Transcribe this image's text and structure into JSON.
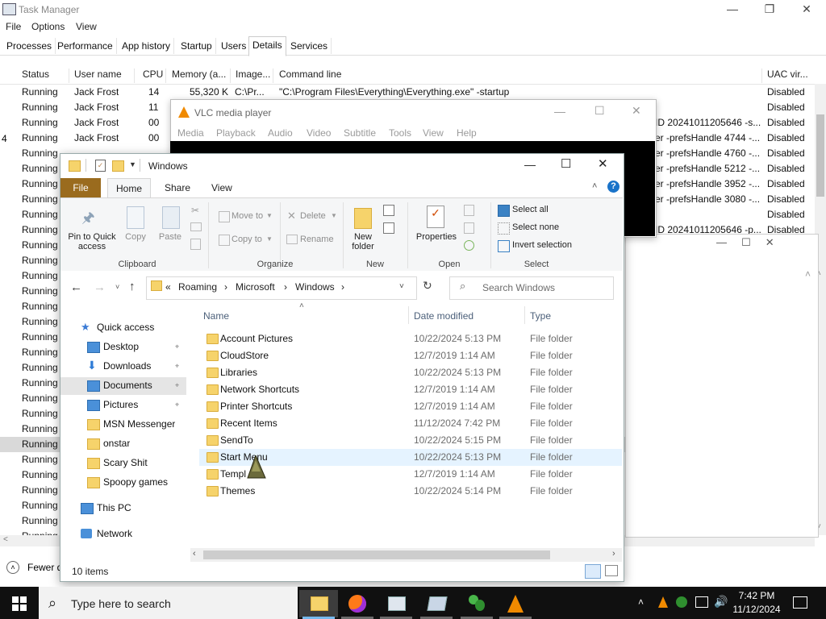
{
  "taskmgr": {
    "title": "Task Manager",
    "menu": [
      "File",
      "Options",
      "View"
    ],
    "tabs": [
      "Processes",
      "Performance",
      "App history",
      "Startup",
      "Users",
      "Details",
      "Services"
    ],
    "active_tab": "Details",
    "columns": [
      "Status",
      "User name",
      "CPU",
      "Memory (a...",
      "Image...",
      "Command line",
      "UAC vir..."
    ],
    "rows": [
      {
        "status": "Running",
        "user": "Jack Frost",
        "cpu": "14",
        "mem": "55,320 K",
        "image": "C:\\Pr...",
        "cmd": "\"C:\\Program Files\\Everything\\Everything.exe\" -startup",
        "uac": "Disabled"
      },
      {
        "status": "Running",
        "user": "Jack Frost",
        "cpu": "11",
        "mem": "",
        "image": "",
        "cmd": "",
        "uac": "Disabled"
      },
      {
        "status": "Running",
        "user": "Jack Frost",
        "cpu": "00",
        "mem": "",
        "image": "",
        "cmd": "ID 20241011205646 -s...",
        "uac": "Disabled"
      },
      {
        "status": "Running",
        "user": "Jack Frost",
        "cpu": "00",
        "mem": "",
        "image": "",
        "cmd": "er -prefsHandle 4744 -...",
        "uac": "Disabled"
      },
      {
        "status": "Running",
        "user": "",
        "cpu": "",
        "mem": "",
        "image": "",
        "cmd": "er -prefsHandle 4760 -...",
        "uac": "Disabled"
      },
      {
        "status": "Running",
        "user": "",
        "cpu": "",
        "mem": "",
        "image": "",
        "cmd": "er -prefsHandle 5212 -...",
        "uac": "Disabled"
      },
      {
        "status": "Running",
        "user": "",
        "cpu": "",
        "mem": "",
        "image": "",
        "cmd": "er -prefsHandle 3952 -...",
        "uac": "Disabled"
      },
      {
        "status": "Running",
        "user": "",
        "cpu": "",
        "mem": "",
        "image": "",
        "cmd": "er -prefsHandle 3080 -...",
        "uac": "Disabled"
      },
      {
        "status": "Running",
        "user": "",
        "cpu": "",
        "mem": "",
        "image": "",
        "cmd": "",
        "uac": "Disabled"
      },
      {
        "status": "Running",
        "user": "",
        "cpu": "",
        "mem": "",
        "image": "",
        "cmd": "ID 20241011205646 -p...",
        "uac": "Disabled"
      },
      {
        "status": "Running"
      },
      {
        "status": "Running"
      },
      {
        "status": "Running"
      },
      {
        "status": "Running"
      },
      {
        "status": "Running"
      },
      {
        "status": "Running"
      },
      {
        "status": "Running"
      },
      {
        "status": "Running"
      },
      {
        "status": "Running"
      },
      {
        "status": "Running"
      },
      {
        "status": "Running"
      },
      {
        "status": "Running"
      },
      {
        "status": "Running"
      },
      {
        "status": "Running"
      },
      {
        "status": "Running"
      },
      {
        "status": "Running"
      },
      {
        "status": "Running"
      },
      {
        "status": "Running"
      },
      {
        "status": "Running"
      },
      {
        "status": "Running"
      }
    ],
    "row_side_number": "4",
    "selected_row": 23,
    "fewer_details": "Fewer d"
  },
  "vlc": {
    "title": "VLC media player",
    "menu": [
      "Media",
      "Playback",
      "Audio",
      "Video",
      "Subtitle",
      "Tools",
      "View",
      "Help"
    ]
  },
  "explorer": {
    "title": "Windows",
    "ribbon_tabs": [
      "File",
      "Home",
      "Share",
      "View"
    ],
    "clipboard": {
      "pin": "Pin to Quick access",
      "copy": "Copy",
      "paste": "Paste",
      "group": "Clipboard"
    },
    "organize": {
      "move_to": "Move to",
      "copy_to": "Copy to",
      "delete": "Delete",
      "rename": "Rename",
      "group": "Organize"
    },
    "new": {
      "new_folder": "New folder",
      "group": "New"
    },
    "open": {
      "properties": "Properties",
      "group": "Open"
    },
    "select": {
      "select_all": "Select all",
      "select_none": "Select none",
      "invert": "Invert selection",
      "group": "Select"
    },
    "breadcrumbs": [
      "Roaming",
      "Microsoft",
      "Windows"
    ],
    "search_placeholder": "Search Windows",
    "nav": [
      {
        "label": "Quick access",
        "icon": "star-icon",
        "indent": 0
      },
      {
        "label": "Desktop",
        "icon": "desktop-icon",
        "indent": 1,
        "pinned": true
      },
      {
        "label": "Downloads",
        "icon": "download-icon",
        "indent": 1,
        "pinned": true
      },
      {
        "label": "Documents",
        "icon": "documents-icon",
        "indent": 1,
        "pinned": true,
        "selected": true
      },
      {
        "label": "Pictures",
        "icon": "pictures-icon",
        "indent": 1,
        "pinned": true
      },
      {
        "label": "MSN Messenger",
        "icon": "folder-icon",
        "indent": 1
      },
      {
        "label": "onstar",
        "icon": "folder-icon",
        "indent": 1
      },
      {
        "label": "Scary Shit",
        "icon": "folder-icon",
        "indent": 1
      },
      {
        "label": "Spoopy games",
        "icon": "folder-icon",
        "indent": 1
      },
      {
        "label": "This PC",
        "icon": "pc-icon",
        "indent": 0
      },
      {
        "label": "Network",
        "icon": "network-icon",
        "indent": 0
      }
    ],
    "columns": {
      "name": "Name",
      "date": "Date modified",
      "type": "Type"
    },
    "files": [
      {
        "name": "Account Pictures",
        "date": "10/22/2024 5:13 PM",
        "type": "File folder"
      },
      {
        "name": "CloudStore",
        "date": "12/7/2019 1:14 AM",
        "type": "File folder"
      },
      {
        "name": "Libraries",
        "date": "10/22/2024 5:13 PM",
        "type": "File folder"
      },
      {
        "name": "Network Shortcuts",
        "date": "12/7/2019 1:14 AM",
        "type": "File folder"
      },
      {
        "name": "Printer Shortcuts",
        "date": "12/7/2019 1:14 AM",
        "type": "File folder"
      },
      {
        "name": "Recent Items",
        "date": "11/12/2024 7:42 PM",
        "type": "File folder"
      },
      {
        "name": "SendTo",
        "date": "10/22/2024 5:15 PM",
        "type": "File folder"
      },
      {
        "name": "Start Menu",
        "date": "10/22/2024 5:13 PM",
        "type": "File folder"
      },
      {
        "name": "Templ",
        "date": "12/7/2019 1:14 AM",
        "type": "File folder"
      },
      {
        "name": "Themes",
        "date": "10/22/2024 5:14 PM",
        "type": "File folder"
      }
    ],
    "hover_row": 7,
    "item_count": "10 items"
  },
  "taskbar": {
    "search_placeholder": "Type here to search",
    "time": "7:42 PM",
    "date": "11/12/2024"
  },
  "colors": {
    "accent": "#0078d7",
    "file_tab": "#9a6b1e",
    "folder": "#f6d36b",
    "taskbar": "#101010"
  }
}
